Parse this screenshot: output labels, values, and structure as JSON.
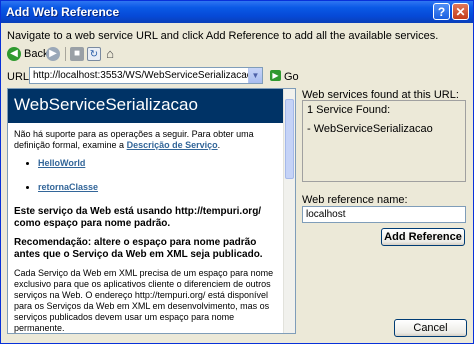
{
  "window": {
    "title": "Add Web Reference",
    "help_icon": "?",
    "close_icon": "✕"
  },
  "instruction": "Navigate to a web service URL and click Add Reference to add all the available services.",
  "toolbar": {
    "back_label": "Back",
    "back_icon": "arrow-left-icon",
    "forward_icon": "arrow-right-icon",
    "stop_icon": "stop-icon",
    "refresh_icon": "refresh-icon",
    "home_icon": "home-icon"
  },
  "url": {
    "label": "URL:",
    "value": "http://localhost:3553/WS/WebServiceSerializacao.asmx",
    "go_label": "Go"
  },
  "browser": {
    "service_title": "WebServiceSerializacao",
    "intro": "Não há suporte para as operações a seguir. Para obter uma definição formal, examine a",
    "intro_link": "Descrição de Serviço",
    "intro_end": ".",
    "operations": [
      "HelloWorld",
      "retornaClasse"
    ],
    "namespace_notice": "Este serviço da Web está usando http://tempuri.org/ como espaço para nome padrão.",
    "recommendation": "Recomendação: altere o espaço para nome padrão antes que o Serviço da Web em XML seja publicado.",
    "details": "Cada Serviço da Web em XML precisa de um espaço para nome exclusivo para que os aplicativos cliente o diferenciem de outros serviços na Web. O endereço http://tempuri.org/ está disponível para os Serviços da Web em XML em desenvolvimento, mas os serviços publicados devem usar um espaço para nome permanente."
  },
  "found": {
    "label": "Web services found at this URL:",
    "count_text": "1 Service Found:",
    "items": [
      "- WebServiceSerializacao"
    ]
  },
  "reference": {
    "label": "Web reference name:",
    "value": "localhost"
  },
  "buttons": {
    "add_reference": "Add Reference",
    "cancel": "Cancel"
  },
  "colors": {
    "title_bar": "#0a59e6",
    "dialog_bg": "#ece9d8",
    "service_header": "#003366",
    "link": "#336699"
  }
}
